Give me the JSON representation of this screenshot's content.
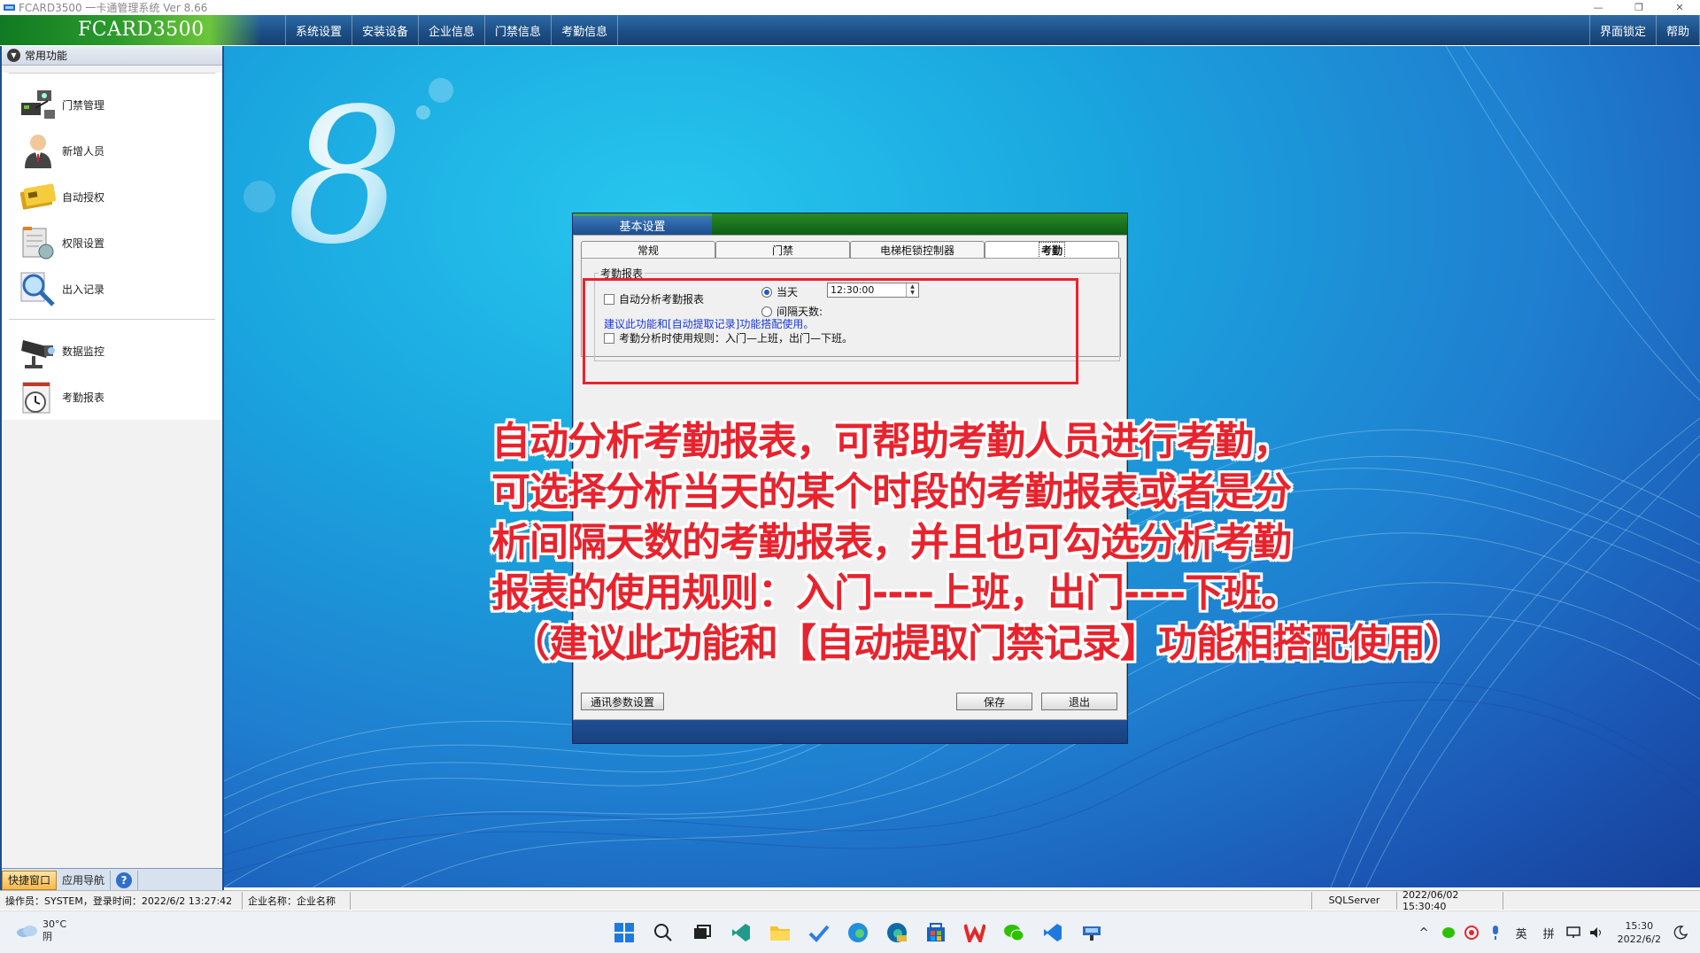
{
  "window": {
    "title": "FCARD3500 一卡通管理系统  Ver 8.66",
    "minimize": "—",
    "restore": "❐",
    "close": "✕"
  },
  "menubar": {
    "brand": "FCARD3500",
    "items": [
      "系统设置",
      "安装设备",
      "企业信息",
      "门禁信息",
      "考勤信息"
    ],
    "right_items": [
      "界面锁定",
      "帮助"
    ]
  },
  "left_panel": {
    "header": "常用功能",
    "group1": [
      {
        "label": "门禁管理",
        "icon": "door-control-icon"
      },
      {
        "label": "新增人员",
        "icon": "person-icon"
      },
      {
        "label": "自动授权",
        "icon": "card-icon"
      },
      {
        "label": "权限设置",
        "icon": "permission-icon"
      },
      {
        "label": "出入记录",
        "icon": "magnifier-icon"
      }
    ],
    "group2": [
      {
        "label": "数据监控",
        "icon": "camera-icon"
      },
      {
        "label": "考勤报表",
        "icon": "clock-icon"
      }
    ],
    "bottom_tabs": [
      "快捷窗口",
      "应用导航"
    ],
    "help_symbol": "?"
  },
  "dialog": {
    "caption": "基本设置",
    "tabs": [
      "常规",
      "门禁",
      "电梯柜锁控制器",
      "考勤"
    ],
    "active_tab": "考勤",
    "group_label": "考勤报表",
    "auto_analyze_label": "自动分析考勤报表",
    "auto_analyze_checked": false,
    "radio_today": "当天",
    "radio_today_selected": true,
    "radio_interval": "间隔天数:",
    "radio_interval_selected": false,
    "time_value": "12:30:00",
    "hint": "建议此功能和[自动提取记录]功能搭配使用。",
    "rule_label": "考勤分析时使用规则：入门—上班，出门—下班。",
    "rule_checked": false,
    "btn_comm": "通讯参数设置",
    "btn_save": "保存",
    "btn_exit": "退出"
  },
  "annotation": {
    "lines": [
      "自动分析考勤报表，可帮助考勤人员进行考勤，",
      "可选择分析当天的某个时段的考勤报表或者是分",
      "析间隔天数的考勤报表，并且也可勾选分析考勤",
      "报表的使用规则：入门----上班，出门----下班。",
      "（建议此功能和【自动提取门禁记录】功能相搭配使用）"
    ],
    "color": "#e8232d"
  },
  "statusbar": {
    "operator": "操作员：SYSTEM，登录时间：2022/6/2 13:27:42",
    "company": "企业名称：企业名称",
    "db": "SQLServer",
    "datetime": "2022/06/02 15:30:40"
  },
  "taskbar": {
    "weather_temp": "30°C",
    "weather_desc": "阴",
    "ime1": "英",
    "ime2": "拼",
    "time": "15:30",
    "date": "2022/6/2"
  },
  "colors": {
    "menubar": "#1c4f86",
    "brand_green": "#2b9a2c",
    "accent_red": "#e8232d",
    "hint_blue": "#1a38d8"
  }
}
